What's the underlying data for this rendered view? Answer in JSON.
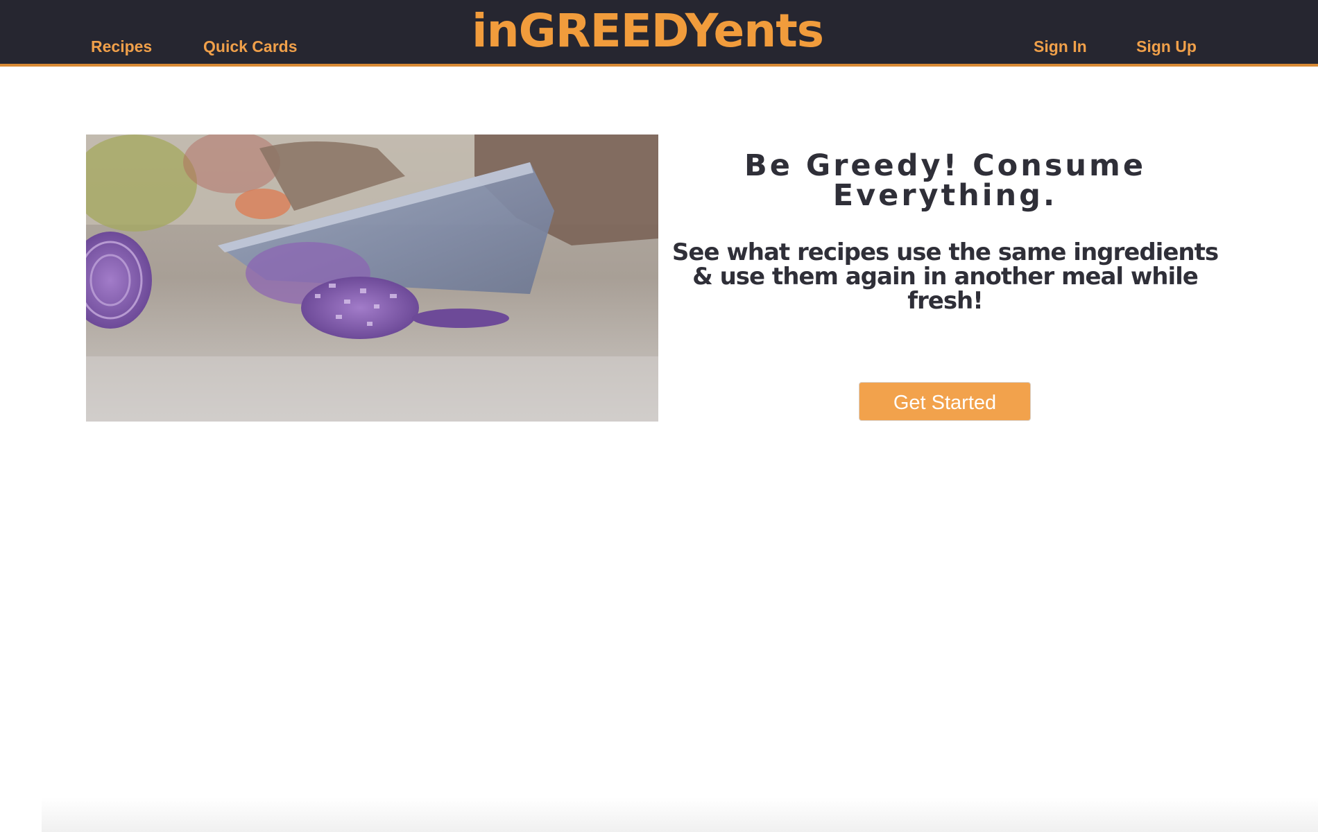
{
  "nav": {
    "left_links": [
      "Recipes",
      "Quick Cards"
    ],
    "logo_text": "inGREEDYents",
    "right_links": [
      "Sign In",
      "Sign Up"
    ]
  },
  "hero": {
    "image_icon": "chopping-onion-photo",
    "headline_line1": "Be Greedy! Consume",
    "headline_line2": "Everything.",
    "subheadline": "See what recipes use the same ingredients & use them again in another meal while fresh!",
    "cta_label": "Get Started"
  },
  "colors": {
    "nav_bg": "#262630",
    "accent": "#f19c3c",
    "nav_border": "#d88a34",
    "button": "#f2a24c",
    "text_dark": "#2f2f38"
  }
}
